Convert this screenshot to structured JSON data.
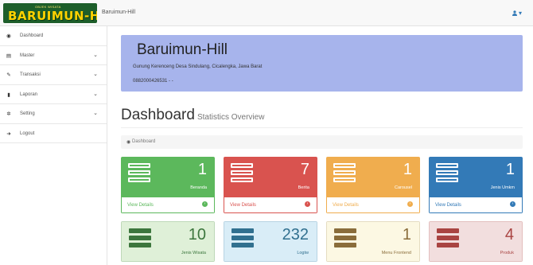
{
  "topbar": {
    "logo_text": "BARUIMUN-HILL",
    "logo_tagline": "OBJEK WISATA",
    "brand": "Baruimun-Hill",
    "user_caret": "▾"
  },
  "sidebar": {
    "items": [
      {
        "label": "Dashboard",
        "icon": "dashboard-icon",
        "glyph": "◉",
        "has_children": false
      },
      {
        "label": "Master",
        "icon": "list-icon",
        "glyph": "▤",
        "has_children": true
      },
      {
        "label": "Transaksi",
        "icon": "edit-icon",
        "glyph": "✎",
        "has_children": true
      },
      {
        "label": "Laporan",
        "icon": "file-icon",
        "glyph": "▮",
        "has_children": true
      },
      {
        "label": "Setting",
        "icon": "gear-icon",
        "glyph": "✲",
        "has_children": true
      },
      {
        "label": "Logout",
        "icon": "logout-icon",
        "glyph": "➜",
        "has_children": false
      }
    ],
    "chevron": "⌄"
  },
  "jumbotron": {
    "title": "Baruimun-Hill",
    "address": "Gunung Kerenceng Desa Sindulang, Cicalengka, Jawa Barat",
    "phone": "0882000426531 - -"
  },
  "page": {
    "title": "Dashboard",
    "subtitle": "Statistics Overview",
    "breadcrumb": "Dashboard"
  },
  "cards": [
    {
      "count": "1",
      "label": "Beranda",
      "footer": "View Details",
      "color": "#5cb85c",
      "accent": "#5cb85c"
    },
    {
      "count": "7",
      "label": "Berita",
      "footer": "View Details",
      "color": "#d9534f",
      "accent": "#d9534f"
    },
    {
      "count": "1",
      "label": "Carousel",
      "footer": "View Details",
      "color": "#f0ad4e",
      "accent": "#f0ad4e"
    },
    {
      "count": "1",
      "label": "Jenis Umkm",
      "footer": "View Details",
      "color": "#337ab7",
      "accent": "#337ab7"
    },
    {
      "count": "10",
      "label": "Jenis Wisata",
      "footer": "",
      "color": "#dff0d8",
      "accent": "#3c763d"
    },
    {
      "count": "232",
      "label": "Logtw",
      "footer": "",
      "color": "#d9edf7",
      "accent": "#31708f"
    },
    {
      "count": "1",
      "label": "Menu Frontend",
      "footer": "",
      "color": "#fcf8e3",
      "accent": "#8a6d3b"
    },
    {
      "count": "4",
      "label": "Produk",
      "footer": "",
      "color": "#f2dede",
      "accent": "#a94442"
    }
  ]
}
